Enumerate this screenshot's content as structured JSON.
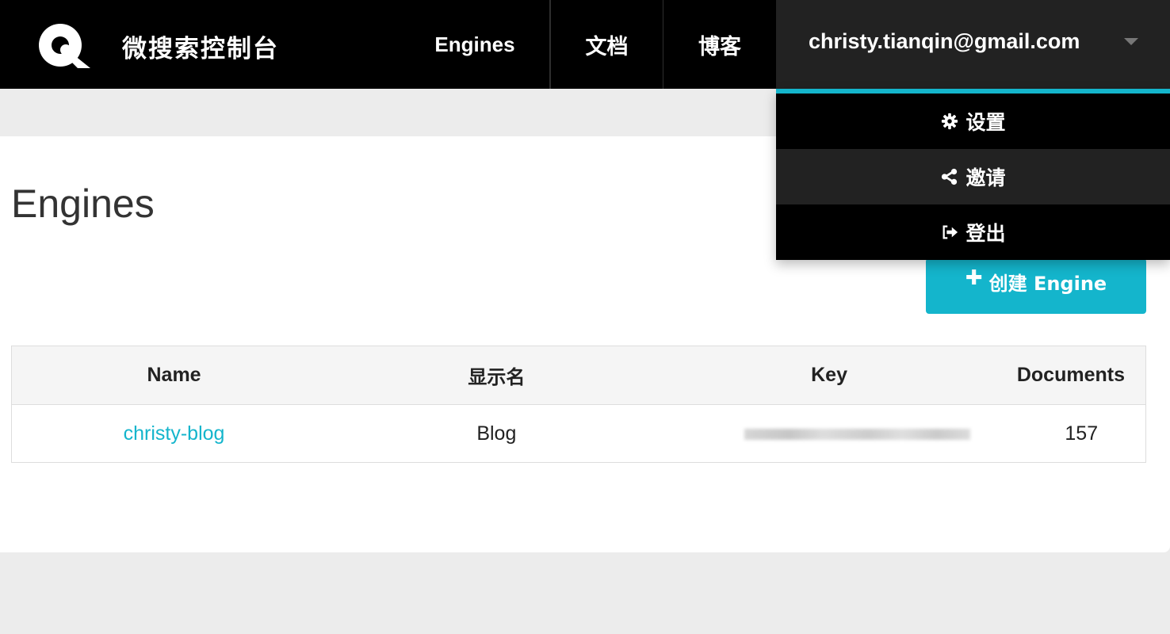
{
  "navbar": {
    "brand": "微搜索控制台",
    "links": {
      "engines": "Engines",
      "docs": "文档",
      "blog": "博客"
    },
    "user_email": "christy.tianqin@gmail.com"
  },
  "dropdown": {
    "accent_color": "#14b5cc",
    "items": [
      {
        "label": "设置",
        "icon": "gear-icon"
      },
      {
        "label": "邀请",
        "icon": "share-icon"
      },
      {
        "label": "登出",
        "icon": "sign-out-icon"
      }
    ]
  },
  "main": {
    "title": "Engines",
    "create_button": {
      "label": "创建 Engine",
      "icon": "plus-icon"
    },
    "table": {
      "columns": [
        "Name",
        "显示名",
        "Key",
        "Documents"
      ],
      "rows": [
        {
          "name": "christy-blog",
          "display_name": "Blog",
          "key": "",
          "documents": "157"
        }
      ]
    }
  },
  "colors": {
    "accent": "#14b5cc",
    "navbar_bg": "#000000",
    "user_menu_bg": "#222222",
    "page_bg": "#ececec"
  }
}
